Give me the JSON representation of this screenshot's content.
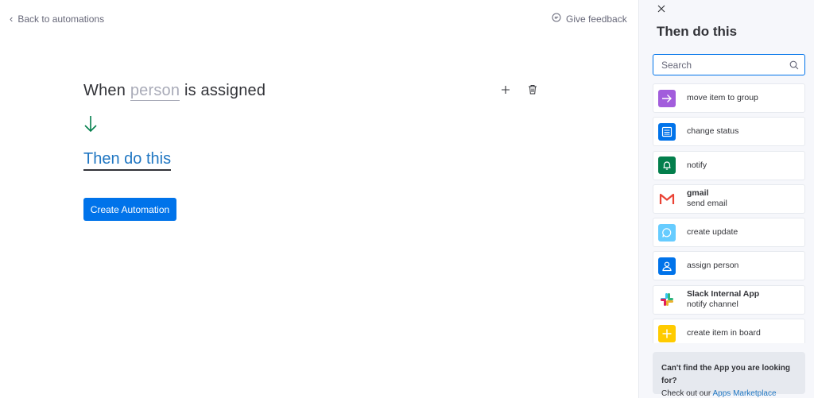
{
  "header": {
    "back_label": "Back to automations",
    "feedback_label": "Give feedback"
  },
  "recipe": {
    "when_prefix": "When",
    "trigger_field": "person",
    "when_suffix": "is assigned",
    "then_label": "Then do this",
    "create_button": "Create Automation"
  },
  "panel": {
    "title": "Then do this",
    "search_placeholder": "Search",
    "items": [
      {
        "icon": "arrow-right-icon",
        "color": "#a25ddc",
        "title": "",
        "label": "move item to group"
      },
      {
        "icon": "status-list-icon",
        "color": "#0073ea",
        "title": "",
        "label": "change status"
      },
      {
        "icon": "bell-icon",
        "color": "#037f4c",
        "title": "",
        "label": "notify"
      },
      {
        "icon": "gmail-icon",
        "color": "#ea4335",
        "title": "gmail",
        "label": "send email"
      },
      {
        "icon": "chat-bubble-icon",
        "color": "#66ccff",
        "title": "",
        "label": "create update"
      },
      {
        "icon": "person-icon",
        "color": "#0073ea",
        "title": "",
        "label": "assign person"
      },
      {
        "icon": "slack-icon",
        "color": "#4a154b",
        "title": "Slack Internal App",
        "label": "notify channel"
      },
      {
        "icon": "plus-icon",
        "color": "#ffcb00",
        "title": "",
        "label": "create item in board"
      }
    ],
    "help_question": "Can't find the App you are looking for?",
    "help_prefix": "Check out our",
    "help_link": "Apps Marketplace"
  }
}
